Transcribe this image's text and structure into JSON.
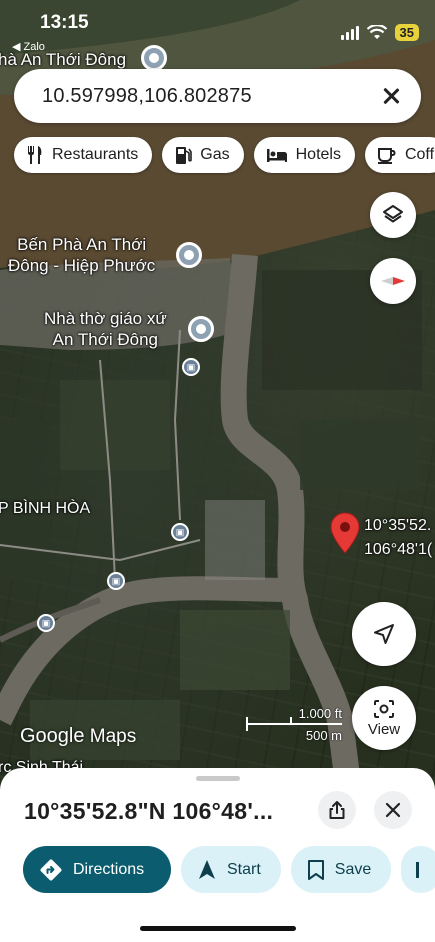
{
  "status_bar": {
    "time": "13:15",
    "back_app": "◀ Zalo",
    "battery": "35"
  },
  "map": {
    "labels": {
      "top_place": "hà An Thới Đông",
      "ferry_line1": "Bến Phà An Thới",
      "ferry_line2": "Đông - Hiệp Phước",
      "church_line1": "Nhà thờ giáo xứ",
      "church_line2": "An Thới Đông",
      "area": "P BÌNH HÒA",
      "bottom_place": "rc Sinh Thái"
    },
    "marker_coords": {
      "lat": "10°35'52.",
      "lng": "106°48'1("
    },
    "google_logo": {
      "word1": "Google",
      "word2": "Maps"
    },
    "scale": {
      "imperial": "1.000 ft",
      "metric": "500 m"
    },
    "view_button_label": "View"
  },
  "search": {
    "value": "10.597998,106.802875"
  },
  "chips": [
    {
      "label": "Restaurants",
      "icon": "fork-knife-icon"
    },
    {
      "label": "Gas",
      "icon": "gas-pump-icon"
    },
    {
      "label": "Hotels",
      "icon": "bed-icon"
    },
    {
      "label": "Coff",
      "icon": "coffee-icon"
    }
  ],
  "sheet": {
    "title": "10°35'52.8\"N 106°48'...",
    "actions": [
      {
        "label": "Directions",
        "icon": "directions-icon"
      },
      {
        "label": "Start",
        "icon": "navigation-arrow-icon"
      },
      {
        "label": "Save",
        "icon": "bookmark-icon"
      }
    ]
  },
  "colors": {
    "primary_button": "#0b5c6e",
    "secondary_button": "#d9f1f7",
    "marker": "#e53935"
  }
}
